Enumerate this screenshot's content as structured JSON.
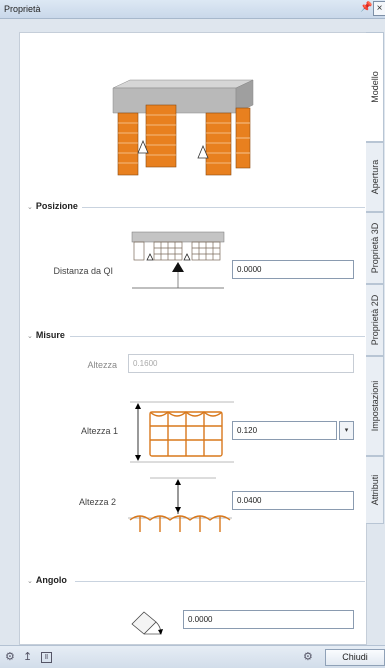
{
  "window": {
    "title": "Proprietà",
    "pin_icon": "pin-icon",
    "close_glyph": "×"
  },
  "tabs": [
    {
      "label": "Modello",
      "active": true
    },
    {
      "label": "Apertura",
      "active": false
    },
    {
      "label": "Proprietà 3D",
      "active": false
    },
    {
      "label": "Proprietà 2D",
      "active": false
    },
    {
      "label": "Impostazioni",
      "active": false
    },
    {
      "label": "Attributi",
      "active": false
    }
  ],
  "sections": {
    "posizione": {
      "title": "Posizione",
      "distanza_label": "Distanza da QI",
      "distanza_value": "0.0000"
    },
    "misure": {
      "title": "Misure",
      "altezza_label": "Altezza",
      "altezza_value": "0.1600",
      "altezza1_label": "Altezza 1",
      "altezza1_value": "0.120",
      "altezza2_label": "Altezza 2",
      "altezza2_value": "0.0400"
    },
    "angolo": {
      "title": "Angolo",
      "angolo_value": "0.0000"
    }
  },
  "bottom": {
    "close_label": "Chiudi"
  },
  "colors": {
    "brick_orange": "#e8801f",
    "slab_gray": "#b9b9b9",
    "accent_blue": "#3b6ea5"
  }
}
